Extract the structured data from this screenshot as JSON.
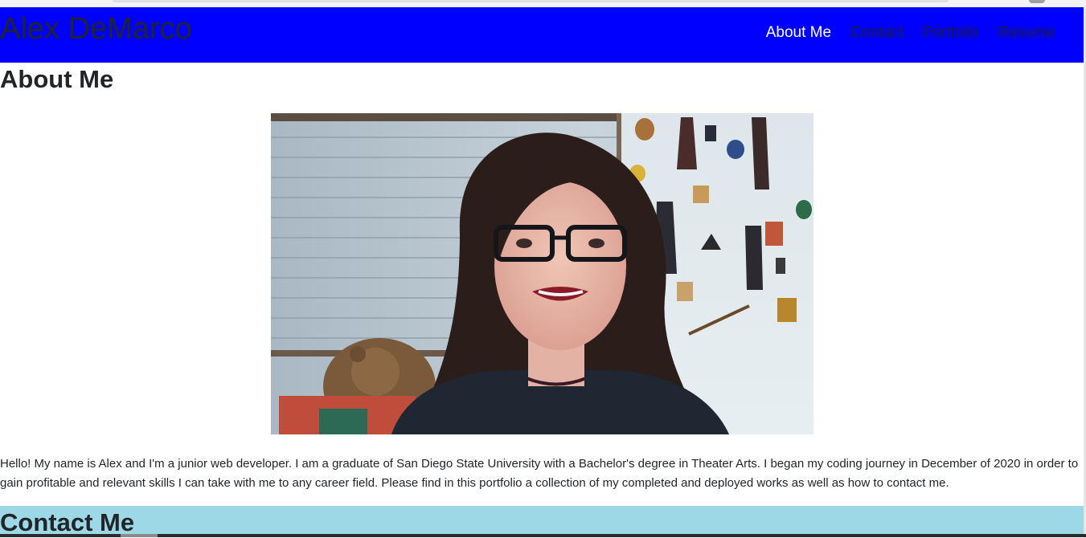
{
  "header": {
    "brand": "Alex DeMarco",
    "nav": [
      {
        "label": "About Me",
        "active": true
      },
      {
        "label": "Contact",
        "active": false
      },
      {
        "label": "Portfolio",
        "active": false
      },
      {
        "label": "Resume",
        "active": false
      }
    ]
  },
  "about": {
    "heading": "About Me",
    "photo_icon": "portrait-photo",
    "text": "Hello! My name is Alex and I'm a junior web developer. I am a graduate of San Diego State University with a Bachelor's degree in Theater Arts. I began my coding journey in December of 2020 in order to gain profitable and relevant skills I can take with me to any career field. Please find in this portfolio a collection of my completed and deployed works as well as how to contact me."
  },
  "contact": {
    "heading": "Contact Me"
  },
  "colors": {
    "navbar_bg": "#0000ff",
    "nav_active": "#ffffff",
    "contact_bg": "#9dd8e6"
  }
}
